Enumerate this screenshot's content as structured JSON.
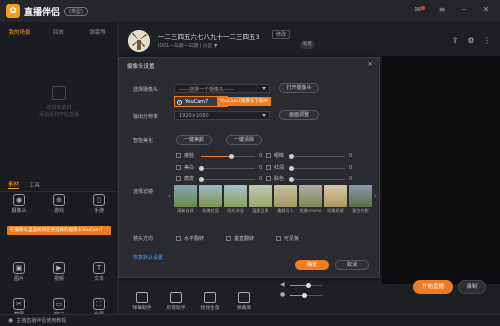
{
  "app": {
    "name": "直播伴侣",
    "version_badge": "(类型)"
  },
  "left_tabs": [
    "我的场景",
    "回放",
    "弹幕等"
  ],
  "empty_scene": {
    "line1": "还没有素材",
    "line2": "添加素材开始直播"
  },
  "source_tabs": [
    "素材",
    "工具"
  ],
  "sources": [
    {
      "label": "摄像头",
      "icon": "camera-icon"
    },
    {
      "label": "游戏",
      "icon": "gamepad-icon"
    },
    {
      "label": "手游",
      "icon": "phone-icon"
    },
    {
      "label": "图片",
      "icon": "image-icon"
    },
    {
      "label": "视频",
      "icon": "video-icon"
    },
    {
      "label": "文本",
      "icon": "text-icon"
    },
    {
      "label": "截屏",
      "icon": "screenshot-icon"
    },
    {
      "label": "窗口",
      "icon": "window-icon"
    },
    {
      "label": "全屏",
      "icon": "fullscreen-icon"
    }
  ],
  "source_tooltip": "在摄像头里面找到您要选择的摄像头YouCam7",
  "status_text": "主播直播伴侣使用教程",
  "stream": {
    "title": "一二三四五六七八九十一二三四五3",
    "edit_label": "修改",
    "sub_info": "ID01一日期一日期 | 分区 ▼",
    "sub_badge": "标签"
  },
  "modal": {
    "title": "摄像头设置",
    "close": "×",
    "rows": {
      "camera_label": "选择摄像头",
      "camera_value": "——选择一个摄像头——",
      "open_camera_btn": "打开摄像头",
      "resolution_label": "输出分辨率",
      "resolution_value": "1920×1080",
      "adjust_btn": "画面调整",
      "beauty_label": "智能美化",
      "beauty_btn1": "一键美颜",
      "beauty_btn2": "一键清除",
      "filter_label": "选择滤镜",
      "direction_label": "镜头方向",
      "reset_link": "恢复默认设置"
    },
    "dropdown_option": "YouCam7",
    "dropdown_tip": "YouCam7摄像头下载中",
    "sliders_left": [
      {
        "label": "瘦脸",
        "value": "0",
        "level": 0.55
      },
      {
        "label": "美白",
        "value": "0",
        "level": 0.0
      },
      {
        "label": "磨皮",
        "value": "0",
        "level": 0.0
      }
    ],
    "sliders_right": [
      {
        "label": "眼睛",
        "value": "0",
        "level": 0.0
      },
      {
        "label": "红润",
        "value": "0",
        "level": 0.0
      },
      {
        "label": "肤色",
        "value": "0",
        "level": 0.0
      }
    ],
    "filters": [
      "清新自然",
      "玫瑰花语",
      "阳光沐浴",
      "温柔日系",
      "素颜可人",
      "优雅cosmo",
      "珍珠质感",
      "复古光影"
    ],
    "direction_options": [
      "水平翻转",
      "垂直翻转",
      "可见板"
    ],
    "confirm_btn": "确定",
    "cancel_btn": "取消"
  },
  "tools": [
    "弹幕助手",
    "房管助手",
    "找找生意",
    "弹幕库"
  ],
  "start_button": "开始直播",
  "record_button": "录制",
  "colors": {
    "accent": "#f07b20",
    "bg": "#1e1f23",
    "link": "#4aa0ff"
  }
}
